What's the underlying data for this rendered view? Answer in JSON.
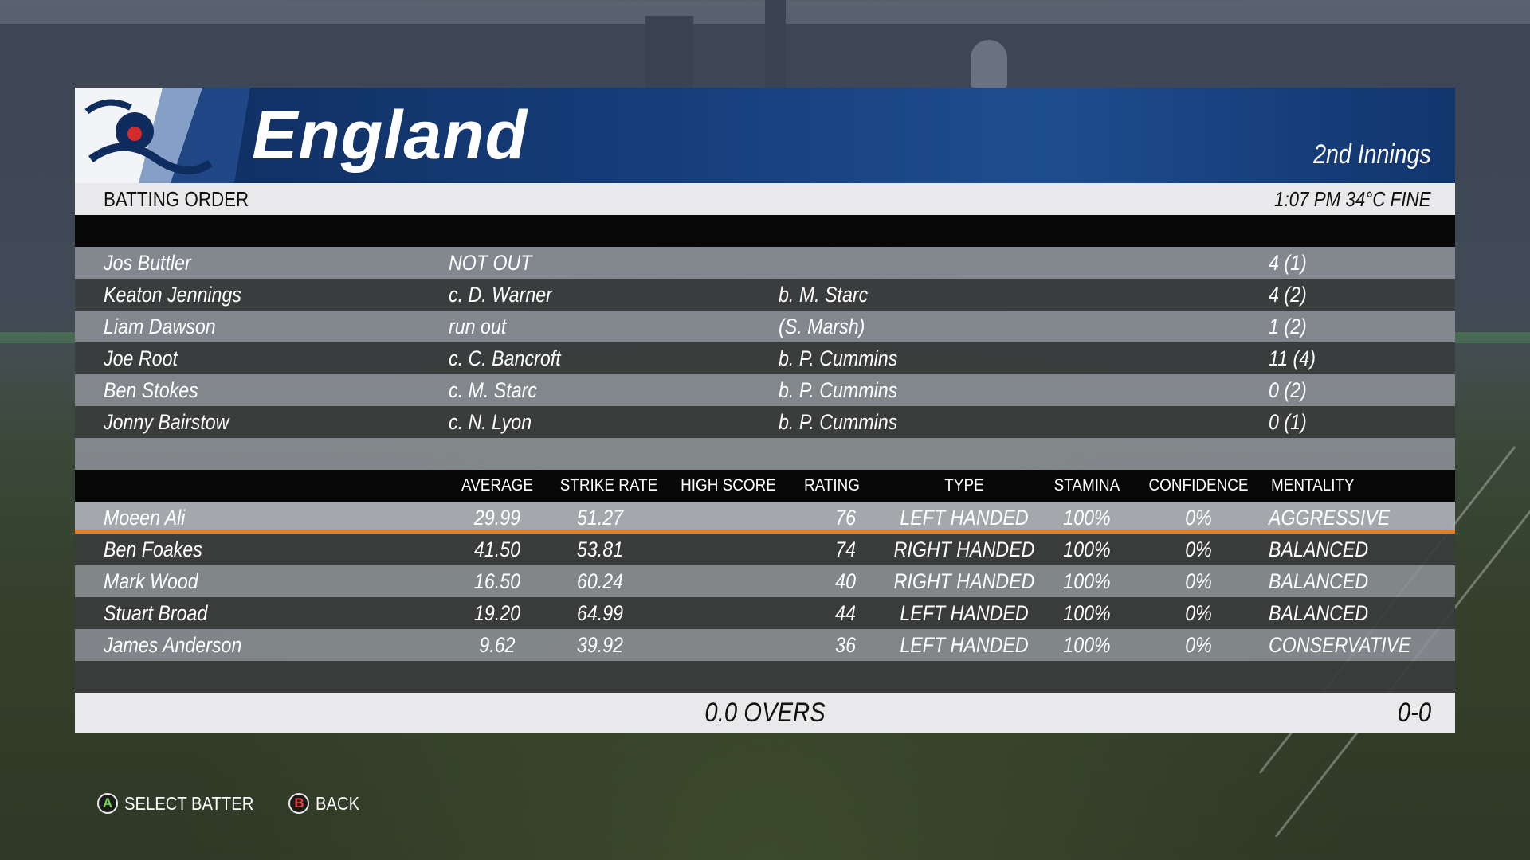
{
  "team": {
    "name": "England",
    "innings": "2nd Innings",
    "crest_icon": "three-lions-crest-icon"
  },
  "info_bar": {
    "label": "BATTING ORDER",
    "conditions": "1:07 PM  34°C  FINE"
  },
  "batted": [
    {
      "name": "Jos Buttler",
      "dismissal": "NOT OUT",
      "bowler": "",
      "score": "4 (1)"
    },
    {
      "name": "Keaton Jennings",
      "dismissal": "c. D. Warner",
      "bowler": "b. M. Starc",
      "score": "4 (2)"
    },
    {
      "name": "Liam Dawson",
      "dismissal": "run out",
      "bowler": "(S. Marsh)",
      "score": "1 (2)"
    },
    {
      "name": "Joe Root",
      "dismissal": "c. C. Bancroft",
      "bowler": "b. P. Cummins",
      "score": "11 (4)"
    },
    {
      "name": "Ben Stokes",
      "dismissal": "c. M. Starc",
      "bowler": "b. P. Cummins",
      "score": "0 (2)"
    },
    {
      "name": "Jonny Bairstow",
      "dismissal": "c. N. Lyon",
      "bowler": "b. P. Cummins",
      "score": "0 (1)"
    }
  ],
  "columns": {
    "average": "AVERAGE",
    "strike_rate": "STRIKE RATE",
    "high_score": "HIGH SCORE",
    "rating": "RATING",
    "type": "TYPE",
    "stamina": "STAMINA",
    "confidence": "CONFIDENCE",
    "mentality": "MENTALITY"
  },
  "available": [
    {
      "name": "Moeen Ali",
      "average": "29.99",
      "strike_rate": "51.27",
      "high_score": "",
      "rating": "76",
      "type": "LEFT HANDED",
      "stamina": "100%",
      "confidence": "0%",
      "mentality": "AGGRESSIVE",
      "selected": true
    },
    {
      "name": "Ben Foakes",
      "average": "41.50",
      "strike_rate": "53.81",
      "high_score": "",
      "rating": "74",
      "type": "RIGHT HANDED",
      "stamina": "100%",
      "confidence": "0%",
      "mentality": "BALANCED"
    },
    {
      "name": "Mark Wood",
      "average": "16.50",
      "strike_rate": "60.24",
      "high_score": "",
      "rating": "40",
      "type": "RIGHT HANDED",
      "stamina": "100%",
      "confidence": "0%",
      "mentality": "BALANCED"
    },
    {
      "name": "Stuart Broad",
      "average": "19.20",
      "strike_rate": "64.99",
      "high_score": "",
      "rating": "44",
      "type": "LEFT HANDED",
      "stamina": "100%",
      "confidence": "0%",
      "mentality": "BALANCED"
    },
    {
      "name": "James Anderson",
      "average": "9.62",
      "strike_rate": "39.92",
      "high_score": "",
      "rating": "36",
      "type": "LEFT HANDED",
      "stamina": "100%",
      "confidence": "0%",
      "mentality": "CONSERVATIVE"
    }
  ],
  "footer": {
    "overs": "0.0 OVERS",
    "score": "0-0"
  },
  "prompts": {
    "select": {
      "button": "A",
      "label": "SELECT BATTER",
      "icon": "a-button-icon"
    },
    "back": {
      "button": "B",
      "label": "BACK",
      "icon": "b-button-icon"
    }
  },
  "colors": {
    "header_blue": "#173f7c",
    "highlight": "#f07c1a",
    "button_a": "#6ad14a",
    "button_b": "#e8413b"
  }
}
